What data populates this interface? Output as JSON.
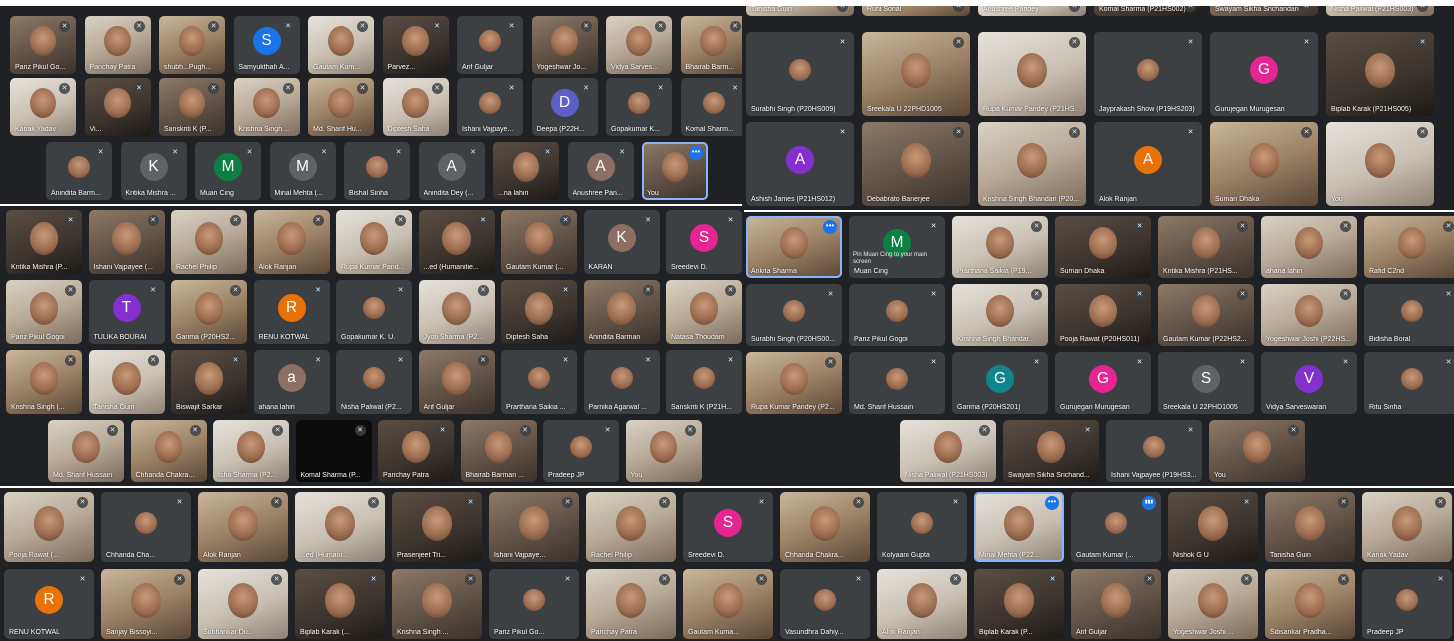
{
  "colors": {
    "panel": "#202124",
    "tile": "#3c4043",
    "avatar_blue": "#1a73e8",
    "avatar_teal": "#12858f",
    "avatar_green": "#0b8043",
    "avatar_purple": "#8430ce",
    "avatar_orange": "#e8710a",
    "avatar_pink": "#e52592",
    "avatar_grey": "#5f6368",
    "avatar_brown": "#8d6e63",
    "active_outline": "#8ab4f8"
  },
  "icons": {
    "muted_mic": "mic-off-icon",
    "more_options": "more-options-icon",
    "speaking": "audio-level-icon"
  },
  "more_glyph": "•••",
  "mic_glyph": "✕",
  "speaking_glyph": "▮▮▮",
  "left_top": {
    "row1": [
      {
        "name": "Pariz Pikul Go...",
        "kind": "video"
      },
      {
        "name": "Parichay Patra",
        "kind": "video"
      },
      {
        "name": "shubh...Pugh...",
        "kind": "video"
      },
      {
        "name": "Samyukthah A...",
        "kind": "avatar",
        "letter": "S",
        "color": "#1a73e8"
      },
      {
        "name": "Gautam Kum...",
        "kind": "video"
      },
      {
        "name": "Parvez...",
        "kind": "video"
      },
      {
        "name": "Arif Guljar",
        "kind": "photo"
      },
      {
        "name": "Yogeshwar Jo...",
        "kind": "video"
      },
      {
        "name": "Vidya Sarves...",
        "kind": "video"
      },
      {
        "name": "Bhairab Barm...",
        "kind": "video"
      }
    ],
    "row2": [
      {
        "name": "Kanak Yadav",
        "kind": "video"
      },
      {
        "name": "Vi...",
        "kind": "video"
      },
      {
        "name": "Sanskriti K (P...",
        "kind": "video"
      },
      {
        "name": "Krishna Singh ...",
        "kind": "video"
      },
      {
        "name": "Md. Sharif Hu...",
        "kind": "video"
      },
      {
        "name": "Diptesh Saha",
        "kind": "video"
      },
      {
        "name": "Ishani Vajpaye...",
        "kind": "photo"
      },
      {
        "name": "Deepa (P22H...",
        "kind": "avatar",
        "letter": "D",
        "color": "#5b5fc7"
      },
      {
        "name": "Gopakumar K...",
        "kind": "photo"
      },
      {
        "name": "Komal Sharm...",
        "kind": "photo"
      }
    ],
    "row3": [
      {
        "name": "Anindita Barm...",
        "kind": "photo"
      },
      {
        "name": "Kritika Mishra ...",
        "kind": "avatar",
        "letter": "K",
        "color": "#5f6368"
      },
      {
        "name": "Muan Cing",
        "kind": "avatar",
        "letter": "M",
        "color": "#0b8043"
      },
      {
        "name": "Minal Mehta (...",
        "kind": "avatar",
        "letter": "M",
        "color": "#5f6368"
      },
      {
        "name": "Bishal Sinha",
        "kind": "photo"
      },
      {
        "name": "Anindita Dey (...",
        "kind": "avatar",
        "letter": "A",
        "color": "#5f6368"
      },
      {
        "name": "...na lahiri",
        "kind": "video"
      },
      {
        "name": "Anushree Pan...",
        "kind": "avatar",
        "letter": "A",
        "color": "#8d6e63"
      },
      {
        "name": "You",
        "kind": "video",
        "active": true
      }
    ]
  },
  "left_mid": {
    "row1": [
      {
        "name": "Kritika Mishra (P...",
        "kind": "video"
      },
      {
        "name": "Ishani Vajpayee (...",
        "kind": "video"
      },
      {
        "name": "Rachel Philip",
        "kind": "video"
      },
      {
        "name": "Alok Ranjan",
        "kind": "video"
      },
      {
        "name": "Rupa Kumar Pand...",
        "kind": "video"
      },
      {
        "name": "...ed (Humanitie...",
        "kind": "video"
      },
      {
        "name": "Gautam Kumar (...",
        "kind": "video"
      },
      {
        "name": "KARAN",
        "kind": "avatar",
        "letter": "K",
        "color": "#8d6e63"
      },
      {
        "name": "Sreedevi D.",
        "kind": "avatar",
        "letter": "S",
        "color": "#e52592"
      }
    ],
    "row2": [
      {
        "name": "Pariz Pikul Gogoi",
        "kind": "video"
      },
      {
        "name": "TULIKA BOURAI",
        "kind": "avatar",
        "letter": "T",
        "color": "#8430ce"
      },
      {
        "name": "Garima (P20HS2...",
        "kind": "video"
      },
      {
        "name": "RENU KOTWAL",
        "kind": "avatar",
        "letter": "R",
        "color": "#e8710a"
      },
      {
        "name": "Gopakumar K. U.",
        "kind": "photo"
      },
      {
        "name": "Jyoti Sharma (P2...",
        "kind": "video"
      },
      {
        "name": "Diptesh Saha",
        "kind": "video"
      },
      {
        "name": "Anindita Barman",
        "kind": "video"
      },
      {
        "name": "Natasa Thoudam",
        "kind": "video"
      }
    ],
    "row3": [
      {
        "name": "Krishna Singh (...",
        "kind": "video"
      },
      {
        "name": "Tanisha Guin",
        "kind": "video"
      },
      {
        "name": "Biswajit Sarkar",
        "kind": "video"
      },
      {
        "name": "ahana lahiri",
        "kind": "avatar",
        "letter": "a",
        "color": "#8d6e63"
      },
      {
        "name": "Nisha Paliwal (P2...",
        "kind": "photo"
      },
      {
        "name": "Arif Guljar",
        "kind": "video"
      },
      {
        "name": "Prarthana Saikia ...",
        "kind": "photo"
      },
      {
        "name": "Parnika Agarwal ...",
        "kind": "photo"
      },
      {
        "name": "Sanskriti K (P21H...",
        "kind": "photo"
      }
    ],
    "row4": [
      {
        "name": "Md. Sharif Hussain",
        "kind": "video"
      },
      {
        "name": "Chhanda Chakra...",
        "kind": "video"
      },
      {
        "name": "Isha Sharma (P2...",
        "kind": "video"
      },
      {
        "name": "Komal Sharma (P...",
        "kind": "dark"
      },
      {
        "name": "Parichay Patra",
        "kind": "video"
      },
      {
        "name": "Bhairab Barman ...",
        "kind": "video"
      },
      {
        "name": "Pradeep JP",
        "kind": "photo"
      },
      {
        "name": "You",
        "kind": "video"
      }
    ]
  },
  "right_top": {
    "row0": [
      {
        "name": "Tanisha Guin"
      },
      {
        "name": "Ruhi Sonal"
      },
      {
        "name": "Anushree Pandey"
      },
      {
        "name": "Komal Sharma (P21HS002)"
      },
      {
        "name": "Swayam Sikha Srichandan"
      },
      {
        "name": "Nisha Paliwal (P21HS003)"
      }
    ],
    "row1": [
      {
        "name": "Surabhi Singh (P20HS009)",
        "kind": "photo"
      },
      {
        "name": "Sreekala U 22PHD1005",
        "kind": "video"
      },
      {
        "name": "Rupa Kumar Pandey (P21HS...)",
        "kind": "video"
      },
      {
        "name": "Jayprakash Show (P19HS203)",
        "kind": "photo"
      },
      {
        "name": "Gurujegan Murugesan",
        "kind": "avatar",
        "letter": "G",
        "color": "#e52592"
      },
      {
        "name": "Biplab Karak (P21HS005)",
        "kind": "video"
      }
    ],
    "row2": [
      {
        "name": "Ashish James (P21HS012)",
        "kind": "avatar",
        "letter": "A",
        "color": "#8430ce"
      },
      {
        "name": "Debabrato Banerjee",
        "kind": "video"
      },
      {
        "name": "Krishna Singh Bhandari (P20...",
        "kind": "video"
      },
      {
        "name": "Alok Ranjan",
        "kind": "avatar",
        "letter": "A",
        "color": "#e8710a"
      },
      {
        "name": "Suman Dhaka",
        "kind": "video"
      },
      {
        "name": "You",
        "kind": "video"
      }
    ]
  },
  "right_mid": {
    "row1": [
      {
        "name": "Ankita Sharma",
        "kind": "video",
        "active": true
      },
      {
        "name": "Muan Cing",
        "kind": "avatar",
        "letter": "M",
        "color": "#0b8043",
        "hint": "Pin Muan Cing to your main screen"
      },
      {
        "name": "Prarthana Saikia (P19...",
        "kind": "video"
      },
      {
        "name": "Suman Dhaka",
        "kind": "video"
      },
      {
        "name": "Kritika Mishra (P21HS...",
        "kind": "video"
      },
      {
        "name": "ahana lahiri",
        "kind": "video"
      },
      {
        "name": "Rafid C2nd",
        "kind": "video"
      }
    ],
    "row2": [
      {
        "name": "Surabhi Singh (P20HS00...",
        "kind": "photo"
      },
      {
        "name": "Pariz Pikul Gogoi",
        "kind": "photo"
      },
      {
        "name": "Krishna Singh Bhandar...",
        "kind": "video"
      },
      {
        "name": "Pooja Rawat (P20HS011)",
        "kind": "video"
      },
      {
        "name": "Gautam Kumar (P22HS2...",
        "kind": "video"
      },
      {
        "name": "Yogeshwar Joshi (P22HS...",
        "kind": "video"
      },
      {
        "name": "Bidisha Boral",
        "kind": "photo"
      }
    ],
    "row3": [
      {
        "name": "Rupa Kumar Pandey (P2...",
        "kind": "video"
      },
      {
        "name": "Md. Sharif Hussain",
        "kind": "photo"
      },
      {
        "name": "Garima (P20HS201)",
        "kind": "avatar",
        "letter": "G",
        "color": "#12858f"
      },
      {
        "name": "Gurujegan Murugesan",
        "kind": "avatar",
        "letter": "G",
        "color": "#e52592"
      },
      {
        "name": "Sreekala U 22PHD1005",
        "kind": "avatar",
        "letter": "S",
        "color": "#5f6368"
      },
      {
        "name": "Vidya Sarveswaran",
        "kind": "avatar",
        "letter": "V",
        "color": "#8430ce"
      },
      {
        "name": "Ritu Sinha",
        "kind": "photo"
      }
    ],
    "row4": [
      {
        "name": "Nisha Paliwal (P21HS003)",
        "kind": "video"
      },
      {
        "name": "Swayam Sikha Srichand...",
        "kind": "video"
      },
      {
        "name": "Ishani Vajpayee (P19HS3...",
        "kind": "photo"
      },
      {
        "name": "You",
        "kind": "video"
      }
    ]
  },
  "bottom": {
    "row1": [
      {
        "name": "Pooja Rawat (...",
        "kind": "video"
      },
      {
        "name": "Chhanda Cha...",
        "kind": "photo"
      },
      {
        "name": "Alok Ranjan",
        "kind": "video"
      },
      {
        "name": "...ed (Humani...",
        "kind": "video"
      },
      {
        "name": "Prasenjeet Tri...",
        "kind": "video"
      },
      {
        "name": "Ishani Vajpaye...",
        "kind": "video"
      },
      {
        "name": "Rachel Philip",
        "kind": "video"
      },
      {
        "name": "Sreedevi D.",
        "kind": "avatar",
        "letter": "S",
        "color": "#e52592"
      },
      {
        "name": "Chhanda Chakra...",
        "kind": "video"
      },
      {
        "name": "Kolyaani Gupta",
        "kind": "photo"
      },
      {
        "name": "Minal Mehta (P22...",
        "kind": "video",
        "active": true
      },
      {
        "name": "Gautam Kumar (...",
        "kind": "photo",
        "speaking": true
      },
      {
        "name": "Nishok G U",
        "kind": "video"
      },
      {
        "name": "Tanisha Guin",
        "kind": "video"
      },
      {
        "name": "Kanak Yadav",
        "kind": "video"
      }
    ],
    "row2": [
      {
        "name": "RENU KOTWAL",
        "kind": "avatar",
        "letter": "R",
        "color": "#e8710a"
      },
      {
        "name": "Sanjay Bissoyi...",
        "kind": "video"
      },
      {
        "name": "Subhankar Du...",
        "kind": "video"
      },
      {
        "name": "Biplab Karak (...",
        "kind": "video"
      },
      {
        "name": "Krishna Singh ...",
        "kind": "video"
      },
      {
        "name": "Pariz Pikul Go...",
        "kind": "photo"
      },
      {
        "name": "Parichay Patra",
        "kind": "video"
      },
      {
        "name": "Gautam Kuma...",
        "kind": "video"
      },
      {
        "name": "Vasundhra Dahiy...",
        "kind": "photo"
      },
      {
        "name": "Alok Ranjan",
        "kind": "video"
      },
      {
        "name": "Biplab Karak (P...",
        "kind": "video"
      },
      {
        "name": "Arif Guljar",
        "kind": "video"
      },
      {
        "name": "Yogeshwar Joshi ...",
        "kind": "video"
      },
      {
        "name": "Sibsankar Pradha...",
        "kind": "video"
      },
      {
        "name": "Pradeep JP",
        "kind": "photo"
      }
    ]
  }
}
